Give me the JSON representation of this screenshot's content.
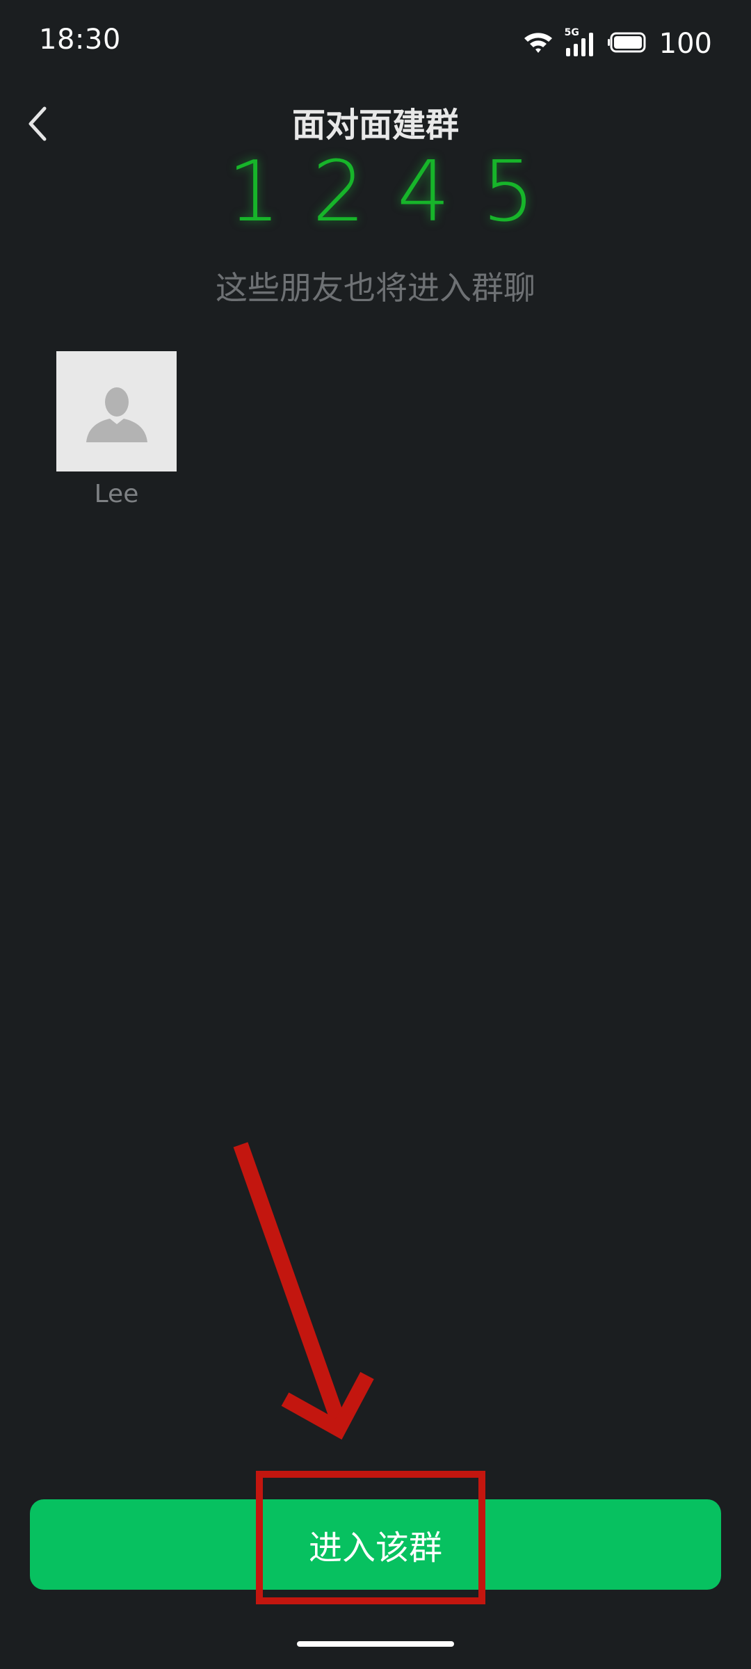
{
  "status_bar": {
    "time": "18:30",
    "network": "5G",
    "battery": "100",
    "icons": [
      "wifi-icon",
      "signal-icon",
      "battery-icon"
    ]
  },
  "nav": {
    "back_icon": "chevron-left-icon",
    "title": "面对面建群"
  },
  "code": {
    "digits": [
      "1",
      "2",
      "4",
      "5"
    ],
    "color": "#17b52a"
  },
  "subtitle": "这些朋友也将进入群聊",
  "members": [
    {
      "name": "Lee",
      "avatar_icon": "default-avatar-icon"
    }
  ],
  "primary_action": {
    "label": "进入该群",
    "color": "#07c160"
  },
  "annotation": {
    "color": "#c3160f",
    "arrow_icon": "arrow-down-icon"
  }
}
